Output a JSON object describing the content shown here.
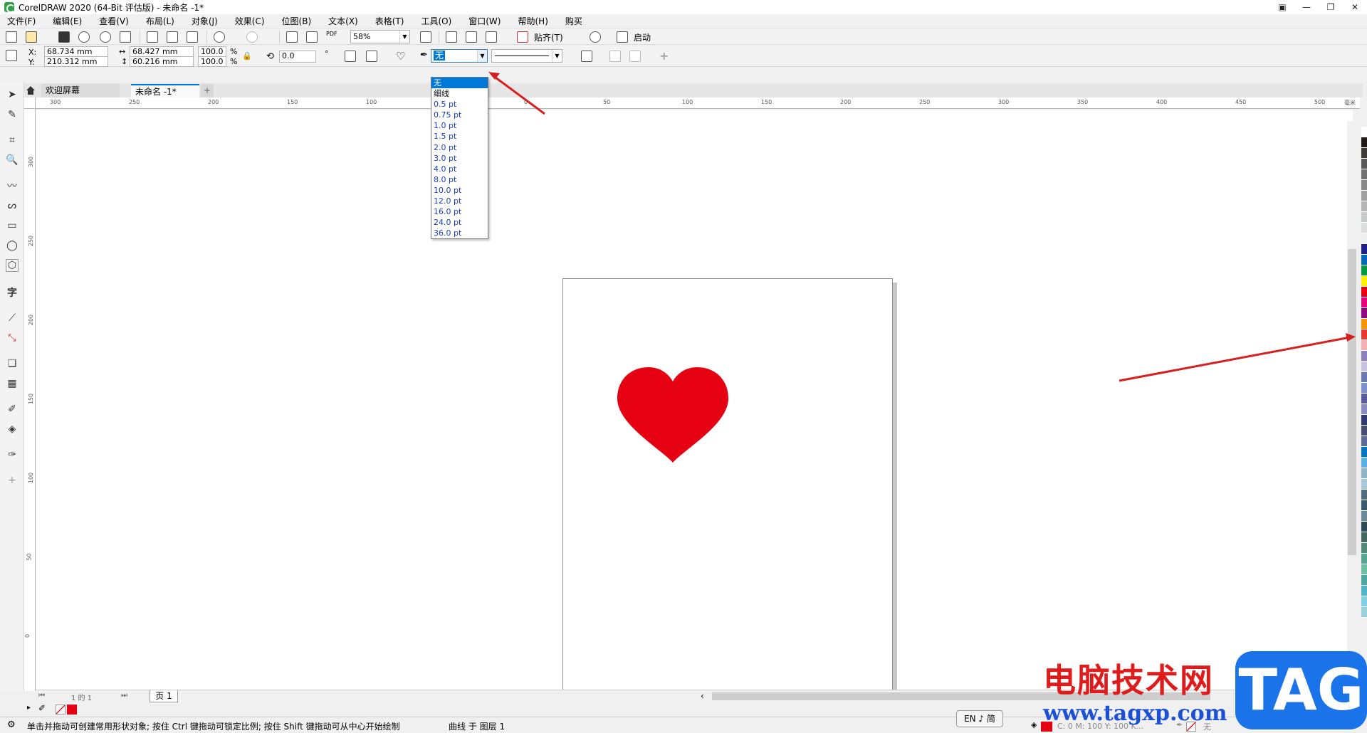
{
  "window": {
    "title": "CorelDRAW 2020 (64-Bit 评估版) - 未命名 -1*",
    "controls": [
      "restore-down",
      "minimize",
      "maximize",
      "close"
    ]
  },
  "menu": [
    "文件(F)",
    "编辑(E)",
    "查看(V)",
    "布局(L)",
    "对象(J)",
    "效果(C)",
    "位图(B)",
    "文本(X)",
    "表格(T)",
    "工具(O)",
    "窗口(W)",
    "帮助(H)",
    "购买"
  ],
  "toolbar": {
    "zoom": "58%",
    "snap_label": "贴齐(T)",
    "start_label": "启动",
    "pdf_label": "PDF"
  },
  "properties": {
    "x_label": "X:",
    "y_label": "Y:",
    "x": "68.734 mm",
    "y": "210.312 mm",
    "width": "68.427 mm",
    "height": "60.216 mm",
    "scale_x": "100.0",
    "scale_y": "100.0",
    "percent": "%",
    "rotation": "0.0",
    "degree": "°",
    "outline_width": "无"
  },
  "outline_dropdown": {
    "items": [
      "无",
      "细线",
      "0.5 pt",
      "0.75 pt",
      "1.0 pt",
      "1.5 pt",
      "2.0 pt",
      "3.0 pt",
      "4.0 pt",
      "8.0 pt",
      "10.0 pt",
      "12.0 pt",
      "16.0 pt",
      "24.0 pt",
      "36.0 pt"
    ],
    "selected": "无"
  },
  "tabs": {
    "welcome": "欢迎屏幕",
    "document": "未命名 -1*"
  },
  "ruler": {
    "h_labels": [
      "300",
      "250",
      "200",
      "150",
      "100",
      "50",
      "0",
      "50",
      "100",
      "150",
      "200",
      "250",
      "300",
      "350",
      "400",
      "450",
      "500"
    ],
    "h_unit": "毫米",
    "v_labels": [
      "300",
      "250",
      "200",
      "150",
      "100",
      "50",
      "0"
    ]
  },
  "heart_color": "#e50012",
  "palette": [
    "#ffffff",
    "#231815",
    "#3e3a39",
    "#595757",
    "#727171",
    "#898989",
    "#9fa0a0",
    "#b5b5b6",
    "#c9caca",
    "#dcdddd",
    "#efefef",
    "#1d2088",
    "#0068b7",
    "#009944",
    "#fff100",
    "#e60012",
    "#e4007f",
    "#920783",
    "#f39800",
    "#e8382f",
    "#f5b2b2",
    "#8f82bc",
    "#c7c3e0",
    "#6a78b4",
    "#7e8fc9",
    "#5a5b9f",
    "#8b8bc0",
    "#2e3a6e",
    "#484b72",
    "#5c6a9c",
    "#0075c2",
    "#5bb1e3",
    "#91b4c7",
    "#a9c8d7",
    "#536c7c",
    "#3d5a6c",
    "#6a8a9a",
    "#2b4a55",
    "#40665e",
    "#4f8a76",
    "#56a592",
    "#6dbea5",
    "#4ea8a0",
    "#4fb5c8",
    "#81cfe0",
    "#98d1d9"
  ],
  "page_nav": {
    "counter": "1 的 1",
    "page_tab": "页 1"
  },
  "status": {
    "hint": "单击并拖动可创建常用形状对象; 按住 Ctrl 键拖动可锁定比例; 按住 Shift 键拖动可从中心开始绘制",
    "object": "曲线 于 图层 1",
    "ime": "EN ♪ 简",
    "fill_info": "C: 0 M: 100 Y: 100 K...",
    "outline_info": "无"
  },
  "watermark": {
    "title": "电脑技术网",
    "url": "www.tagxp.com",
    "badge": "TAG"
  }
}
